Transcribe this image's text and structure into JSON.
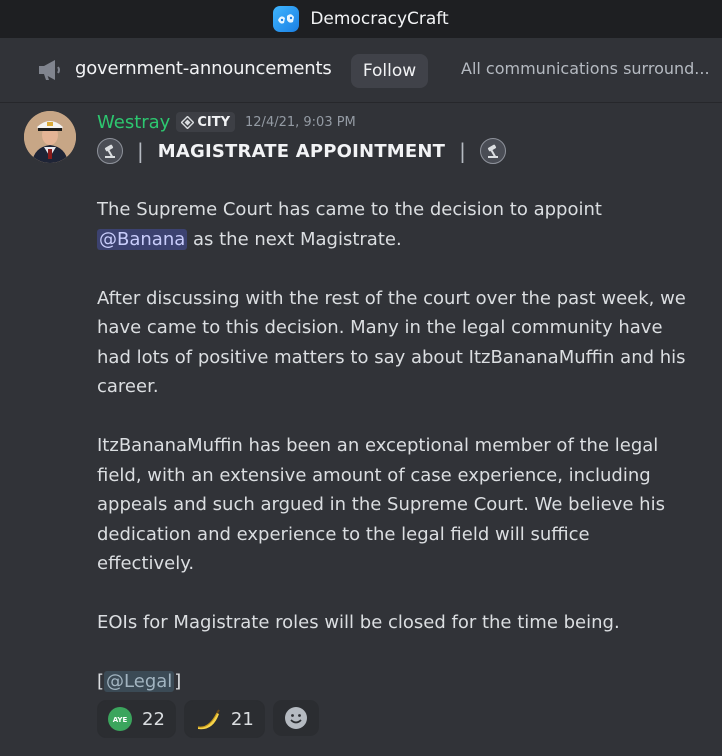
{
  "window": {
    "server_name": "DemocracyCraft"
  },
  "channel": {
    "name": "government-announcements",
    "follow_label": "Follow",
    "topic": "All communications surround..."
  },
  "message": {
    "author": "Westray",
    "author_color": "#2dc770",
    "tag": "CITY",
    "timestamp": "12/4/21, 9:03 PM",
    "heading": "MAGISTRATE APPOINTMENT",
    "heading_separator": "|",
    "paragraph1_before": "The Supreme Court has came to the decision to appoint",
    "mention_user": "@Banana",
    "paragraph1_after": " as the next Magistrate.",
    "paragraph2": "After discussing with the rest of the court over the past week, we have came to this decision. Many in the legal community have had lots of positive matters to say about ItzBananaMuffin and his career.",
    "paragraph3": "ItzBananaMuffin has been an exceptional member of the legal field, with an extensive amount of case experience, including appeals and such argued in the Supreme Court. We believe his dedication and experience to the legal field will suffice effectively.",
    "paragraph4": "EOIs for Magistrate roles will be closed for the time being.",
    "role_open": "[",
    "role_mention": "@Legal",
    "role_close": "]"
  },
  "reactions": [
    {
      "icon": "aye-emoji-icon",
      "emoji_text": "AYE",
      "count": "22"
    },
    {
      "icon": "banana-emoji-icon",
      "count": "21"
    }
  ],
  "colors": {
    "background": "#313338",
    "titlebar": "#1e1f22",
    "mention_bg": "#3c4270"
  }
}
